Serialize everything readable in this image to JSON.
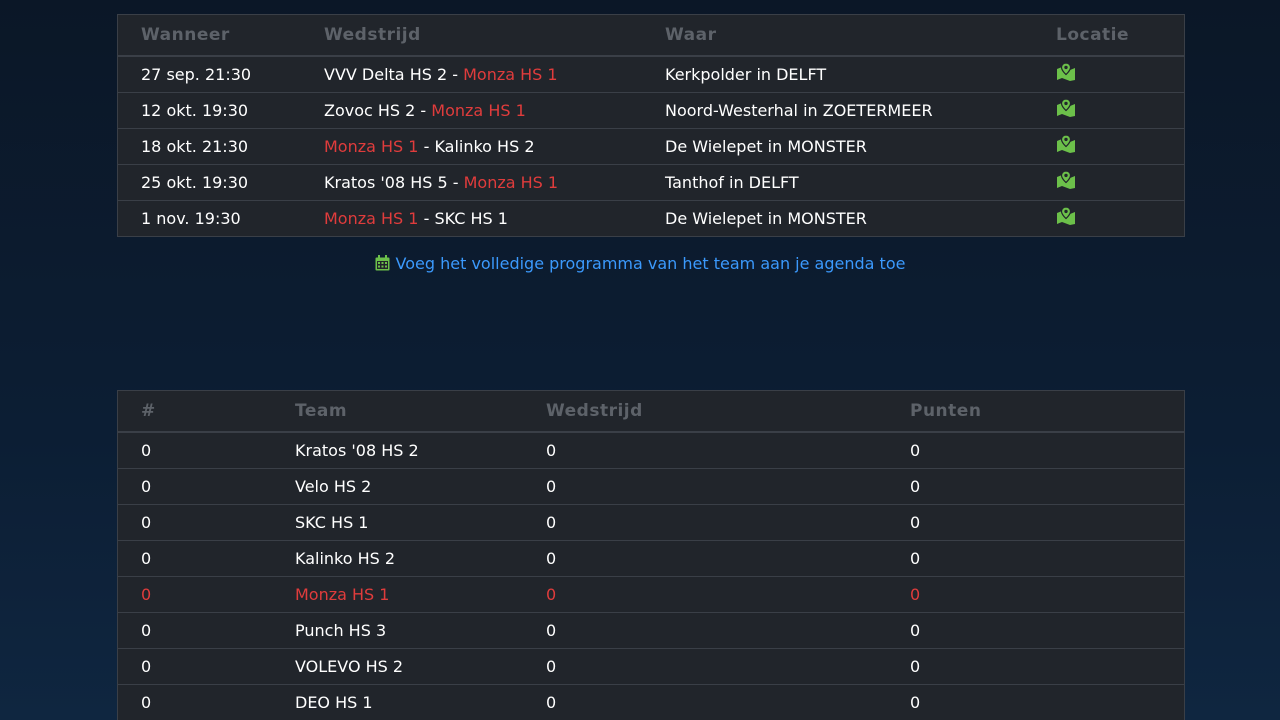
{
  "schedule": {
    "headers": [
      "Wanneer",
      "Wedstrijd",
      "Waar",
      "Locatie"
    ],
    "rows": [
      {
        "when": "27 sep. 21:30",
        "home": "VVV Delta HS 2",
        "sep": " - ",
        "away": "Monza HS 1",
        "highlight": "away",
        "where": "Kerkpolder in DELFT",
        "location_icon": "map-marker-icon"
      },
      {
        "when": "12 okt. 19:30",
        "home": "Zovoc HS 2",
        "sep": " - ",
        "away": "Monza HS 1",
        "highlight": "away",
        "where": "Noord-Westerhal in ZOETERMEER",
        "location_icon": "map-marker-icon"
      },
      {
        "when": "18 okt. 21:30",
        "home": "Monza HS 1",
        "sep": " - ",
        "away": "Kalinko HS 2",
        "highlight": "home",
        "where": "De Wielepet in MONSTER",
        "location_icon": "map-marker-icon"
      },
      {
        "when": "25 okt. 19:30",
        "home": "Kratos '08 HS 5",
        "sep": " - ",
        "away": "Monza HS 1",
        "highlight": "away",
        "where": "Tanthof in DELFT",
        "location_icon": "map-marker-icon"
      },
      {
        "when": "1 nov. 19:30",
        "home": "Monza HS 1",
        "sep": " - ",
        "away": "SKC HS 1",
        "highlight": "home",
        "where": "De Wielepet in MONSTER",
        "location_icon": "map-marker-icon"
      }
    ]
  },
  "agenda_link": {
    "icon": "calendar-icon",
    "text": "Voeg het volledige programma van het team aan je agenda toe"
  },
  "standings": {
    "headers": [
      "#",
      "Team",
      "Wedstrijd",
      "Punten"
    ],
    "rows": [
      {
        "rank": "0",
        "team": "Kratos '08 HS 2",
        "matches": "0",
        "points": "0",
        "highlight": false
      },
      {
        "rank": "0",
        "team": "Velo HS 2",
        "matches": "0",
        "points": "0",
        "highlight": false
      },
      {
        "rank": "0",
        "team": "SKC HS 1",
        "matches": "0",
        "points": "0",
        "highlight": false
      },
      {
        "rank": "0",
        "team": "Kalinko HS 2",
        "matches": "0",
        "points": "0",
        "highlight": false
      },
      {
        "rank": "0",
        "team": "Monza HS 1",
        "matches": "0",
        "points": "0",
        "highlight": true
      },
      {
        "rank": "0",
        "team": "Punch HS 3",
        "matches": "0",
        "points": "0",
        "highlight": false
      },
      {
        "rank": "0",
        "team": "VOLEVO HS 2",
        "matches": "0",
        "points": "0",
        "highlight": false
      },
      {
        "rank": "0",
        "team": "DEO HS 1",
        "matches": "0",
        "points": "0",
        "highlight": false
      }
    ]
  },
  "colors": {
    "highlight": "#e03c3c",
    "link": "#3b99fc",
    "icon_green": "#6cc04a",
    "table_bg": "#21252b",
    "header_text": "#5d6269"
  }
}
